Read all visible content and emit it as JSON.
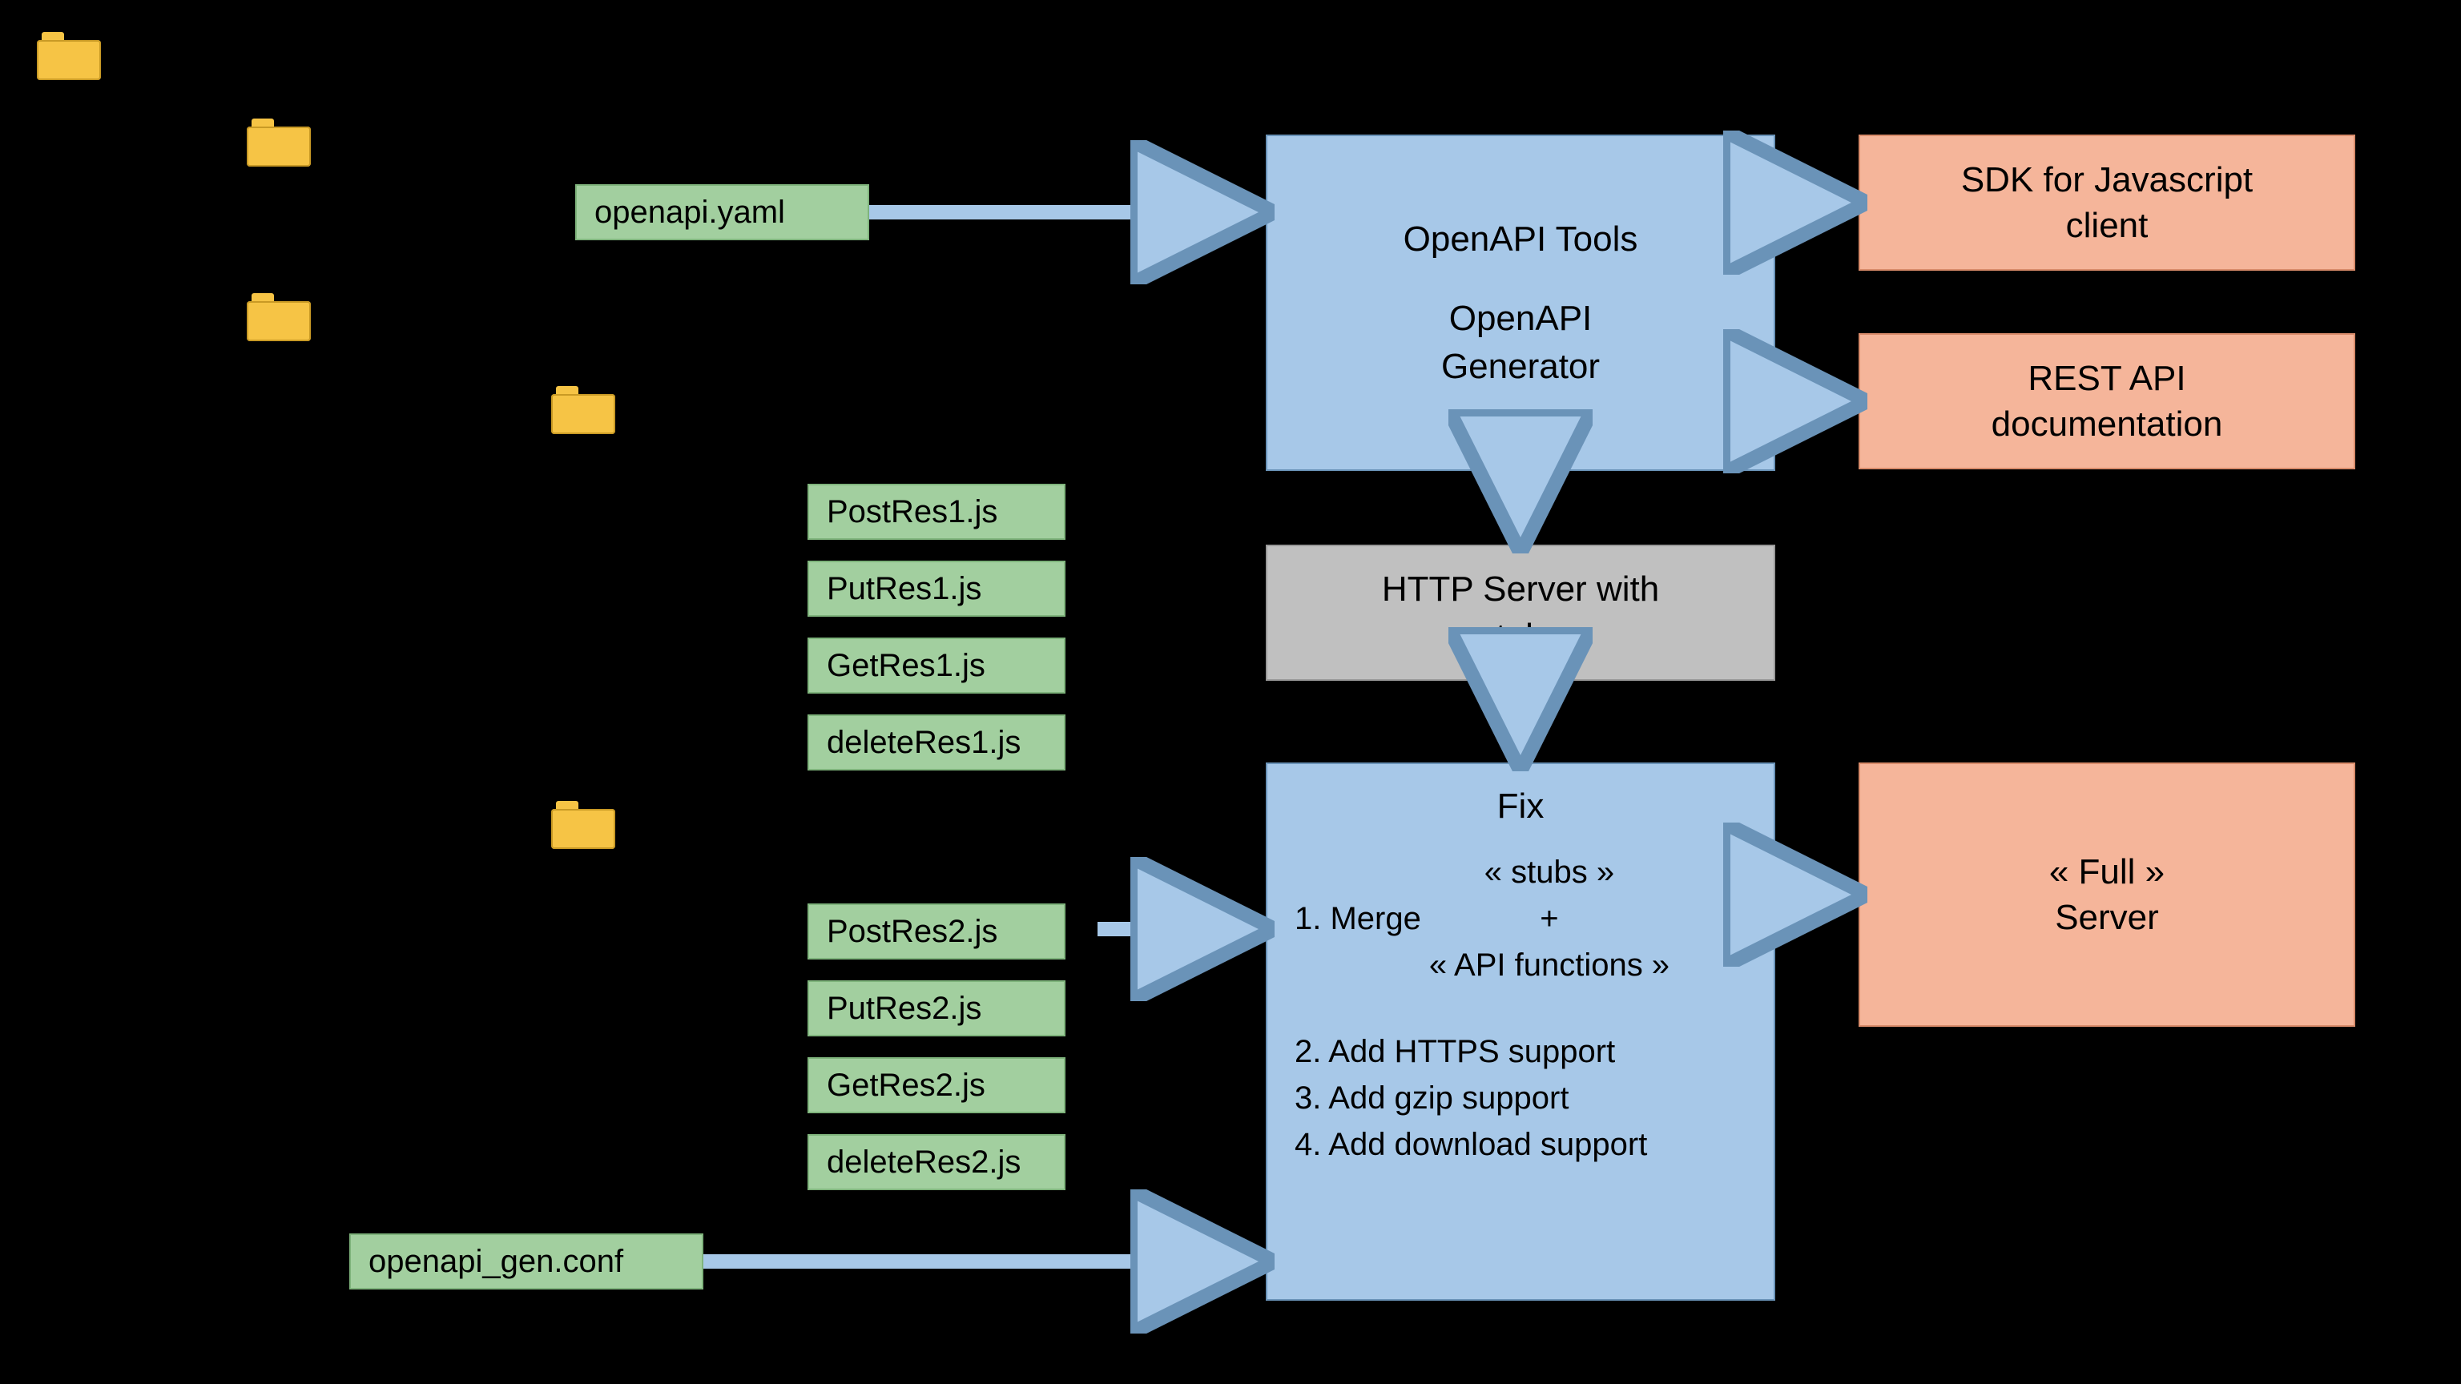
{
  "files": {
    "openapi_yaml": "openapi.yaml",
    "res1": {
      "post": "PostRes1.js",
      "put": "PutRes1.js",
      "get": "GetRes1.js",
      "del": "deleteRes1.js"
    },
    "res2": {
      "post": "PostRes2.js",
      "put": "PutRes2.js",
      "get": "GetRes2.js",
      "del": "deleteRes2.js"
    },
    "openapi_conf": "openapi_gen.conf"
  },
  "blocks": {
    "openapi_tools_l1": "OpenAPI Tools",
    "openapi_tools_l2": "OpenAPI",
    "openapi_tools_l3": "Generator",
    "http_server_l1": "HTTP Server with",
    "http_server_l2": "« stubs »",
    "sdk_l1": "SDK for Javascript",
    "sdk_l2": "client",
    "doc_l1": "REST API",
    "doc_l2": "documentation",
    "full_l1": "« Full »",
    "full_l2": "Server"
  },
  "fix": {
    "title": "Fix",
    "merge_label": "1. Merge",
    "merge_sub1": "« stubs »",
    "merge_plus": "+",
    "merge_sub2": "« API functions »",
    "i2": "2. Add HTTPS support",
    "i3": "3. Add gzip support",
    "i4": "4. Add download support"
  }
}
